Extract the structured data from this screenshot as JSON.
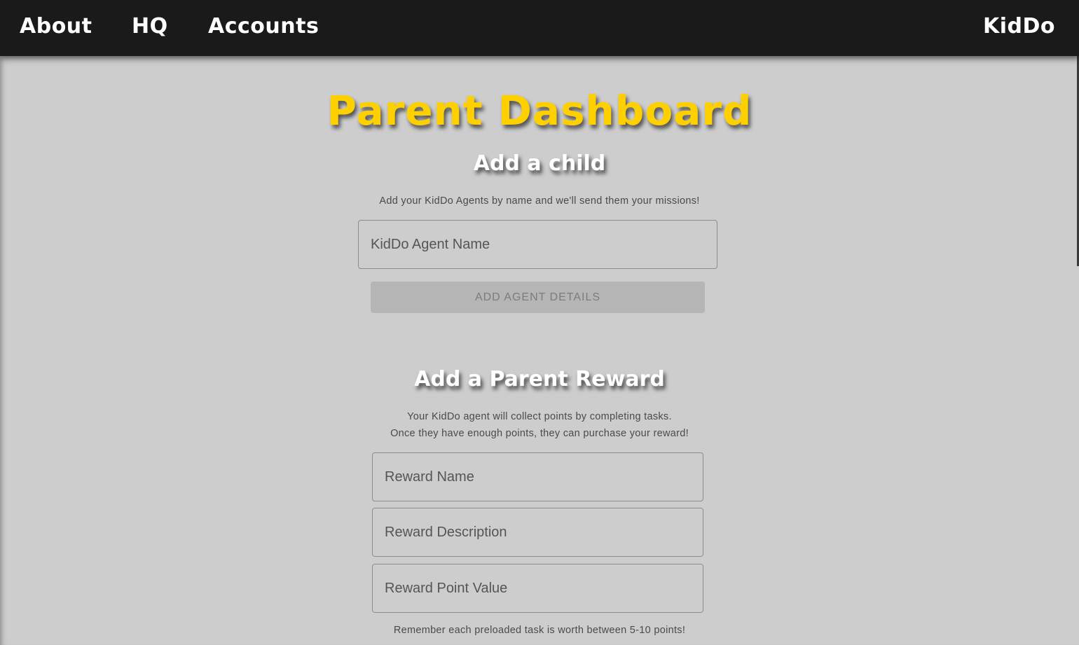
{
  "nav": {
    "links": [
      {
        "label": "About"
      },
      {
        "label": "HQ"
      },
      {
        "label": "Accounts"
      }
    ],
    "brand": "KidDo"
  },
  "page": {
    "title": "Parent Dashboard"
  },
  "add_child": {
    "title": "Add a child",
    "description": "Add your KidDo Agents by name and we'll send them your missions!",
    "agent_name_placeholder": "KidDo Agent Name",
    "agent_name_value": "",
    "button_label": "ADD AGENT DETAILS"
  },
  "add_reward": {
    "title": "Add a Parent Reward",
    "description_line1": "Your KidDo agent will collect points by completing tasks.",
    "description_line2": "Once they have enough points, they can purchase your reward!",
    "reward_name_placeholder": "Reward Name",
    "reward_description_placeholder": "Reward Description",
    "reward_points_placeholder": "Reward Point Value",
    "note": "Remember each preloaded task is worth between 5-10 points!"
  },
  "colors": {
    "navbar_bg": "#1a1a1a",
    "page_bg": "#cdcdcd",
    "title_accent": "#ffd000",
    "disabled_button": "#b5b5b5"
  }
}
